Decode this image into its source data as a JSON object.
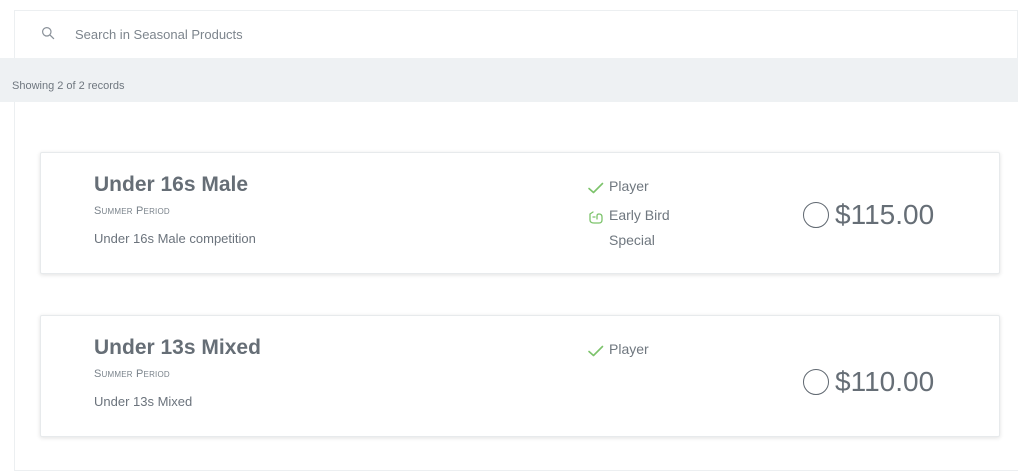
{
  "search": {
    "placeholder": "Search in Seasonal Products",
    "value": ""
  },
  "records": {
    "summary": "Showing 2 of 2 records"
  },
  "products": [
    {
      "title": "Under 16s Male",
      "period": "Summer Period",
      "description": "Under 16s Male competition",
      "tags": [
        {
          "icon": "check-icon",
          "label": "Player"
        },
        {
          "icon": "bird-icon",
          "label": "Early Bird Special"
        }
      ],
      "price": "$115.00",
      "selected": false
    },
    {
      "title": "Under 13s Mixed",
      "period": "Summer Period",
      "description": "Under 13s Mixed",
      "tags": [
        {
          "icon": "check-icon",
          "label": "Player"
        }
      ],
      "price": "$110.00",
      "selected": false
    }
  ],
  "colors": {
    "accent_green": "#7cc36b",
    "text": "#6b737c",
    "title": "#666e76",
    "records_bar": "#eef1f3"
  }
}
